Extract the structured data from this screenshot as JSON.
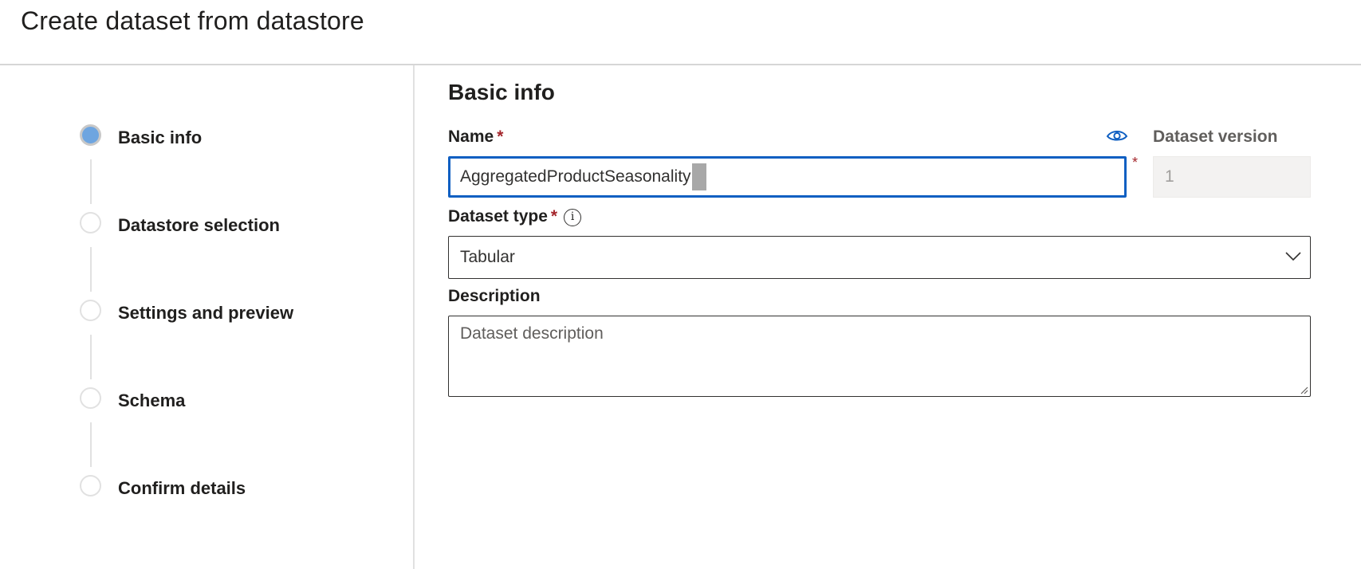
{
  "header": {
    "title": "Create dataset from datastore"
  },
  "steps": [
    {
      "label": "Basic info",
      "active": true
    },
    {
      "label": "Datastore selection",
      "active": false
    },
    {
      "label": "Settings and preview",
      "active": false
    },
    {
      "label": "Schema",
      "active": false
    },
    {
      "label": "Confirm details",
      "active": false
    }
  ],
  "form": {
    "section_title": "Basic info",
    "name_label": "Name",
    "required_mark": "*",
    "name_value": "AggregatedProductSeasonality",
    "version_label": "Dataset version",
    "version_value": "1",
    "type_label": "Dataset type",
    "type_value": "Tabular",
    "description_label": "Description",
    "description_placeholder": "Dataset description"
  },
  "icons": {
    "reveal": "eye-icon",
    "info": "info-icon",
    "dropdown": "chevron-down-icon"
  },
  "colors": {
    "accent": "#0f5fc2",
    "active_step": "#6ea5e0",
    "required": "#a4262c"
  }
}
